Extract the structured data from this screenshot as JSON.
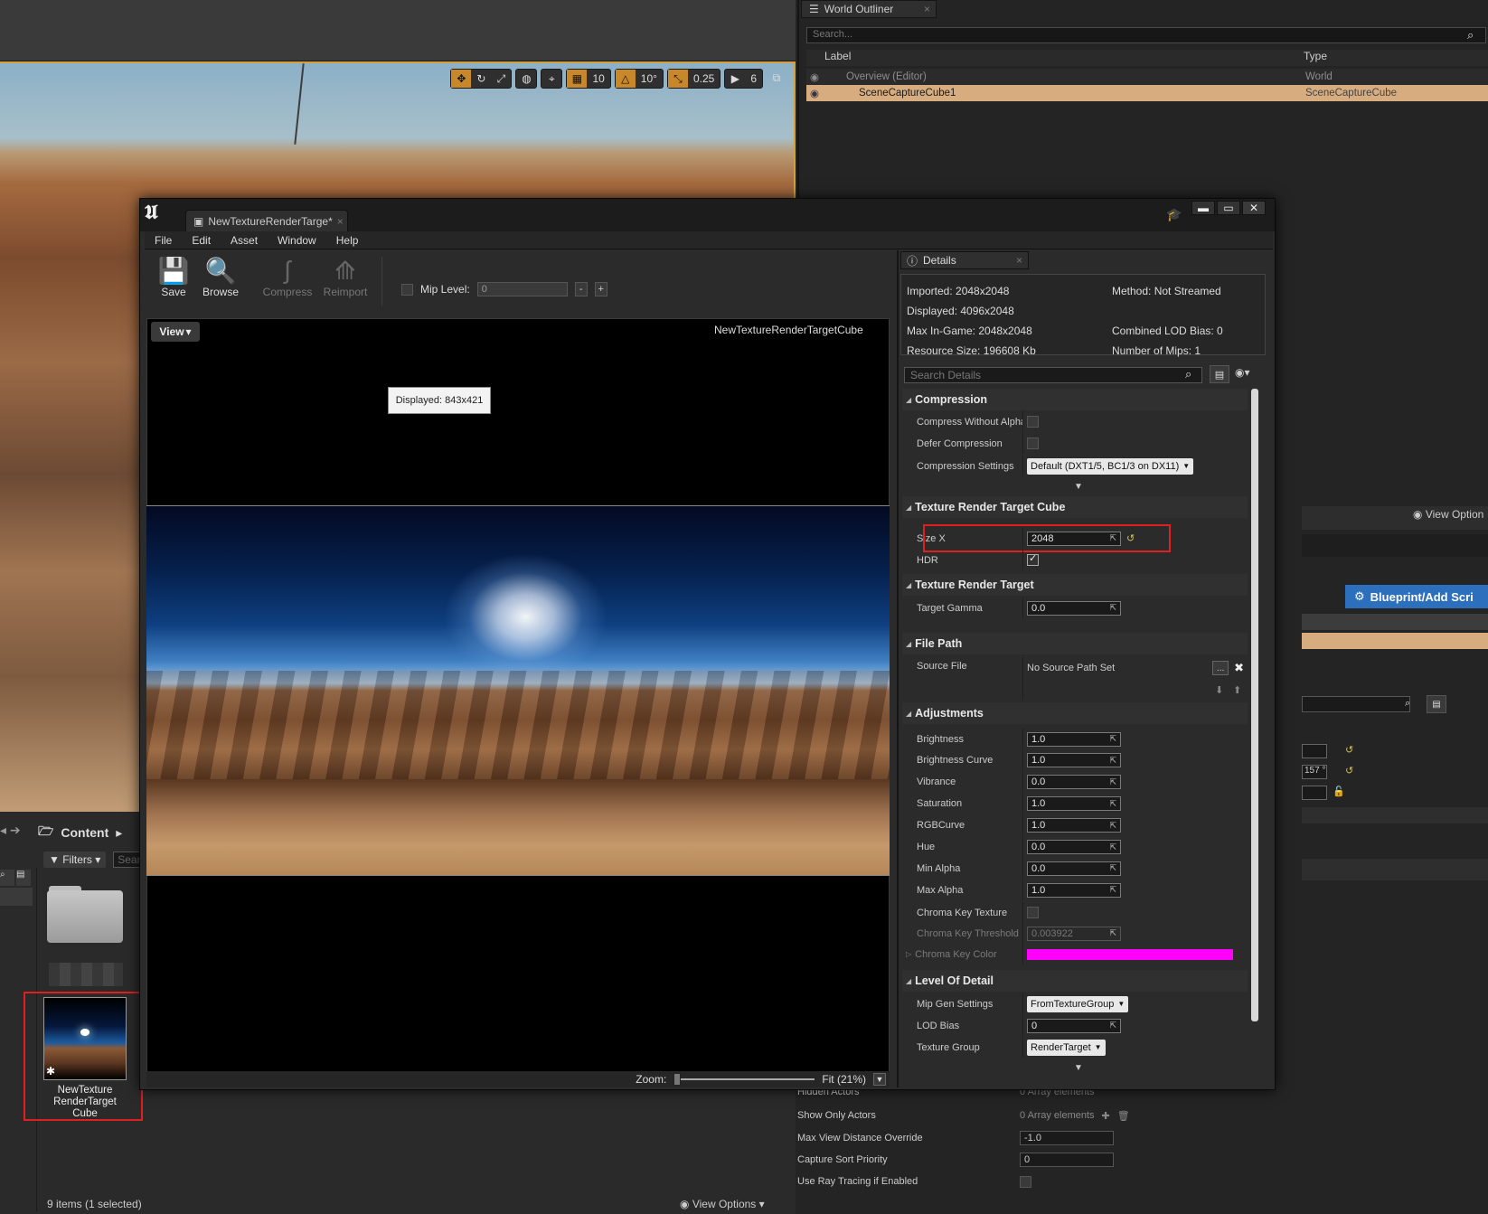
{
  "background": {
    "viewport_toolbar": {
      "grid_snap": "10",
      "rotation_snap": "10°",
      "scale_snap": "0.25",
      "camera_speed": "6"
    },
    "outliner": {
      "tab_label": "World Outliner",
      "search_placeholder": "Search...",
      "col_label": "Label",
      "col_type": "Type",
      "rows": [
        {
          "label": "Overview (Editor)",
          "type": "World"
        },
        {
          "label": "SceneCaptureCube1",
          "type": "SceneCaptureCube"
        }
      ]
    },
    "right_panel": {
      "view_options": "View Option",
      "blueprint_button": "Blueprint/Add Scri",
      "partial_value": "157 °"
    },
    "content_browser": {
      "breadcrumb": "Content",
      "filters": "Filters",
      "search_placeholder": "Search",
      "asset_name": "NewTexture RenderTarget Cube",
      "status": "9 items (1 selected)",
      "view_options": "View Options"
    },
    "props": {
      "hidden_actors_label": "Hidden Actors",
      "hidden_actors_value": "0 Array elements",
      "show_only_actors_label": "Show Only Actors",
      "show_only_actors_value": "0 Array elements",
      "max_view_distance_label": "Max View Distance Override",
      "max_view_distance_value": "-1.0",
      "capture_sort_priority_label": "Capture Sort Priority",
      "capture_sort_priority_value": "0",
      "ray_tracing_label": "Use Ray Tracing if Enabled"
    }
  },
  "texture_editor": {
    "tab_title": "NewTextureRenderTarge*",
    "menu": [
      "File",
      "Edit",
      "Asset",
      "Window",
      "Help"
    ],
    "toolbar": {
      "save": "Save",
      "browse": "Browse",
      "compress": "Compress",
      "reimport": "Reimport",
      "mip_label": "Mip Level:",
      "mip_value": "0"
    },
    "viewport": {
      "view_button": "View",
      "asset_name": "NewTextureRenderTargetCube",
      "tooltip": "Displayed: 843x421",
      "zoom_label": "Zoom:",
      "zoom_value": "Fit (21%)",
      "zoom_fraction": 0.21
    },
    "details": {
      "tab_label": "Details",
      "info": {
        "imported": "Imported: 2048x2048",
        "method": "Method: Not Streamed",
        "displayed": "Displayed: 4096x2048",
        "max_ingame": "Max In-Game: 2048x2048",
        "combined_lod": "Combined LOD Bias: 0",
        "resource_size": "Resource Size: 196608 Kb",
        "num_mips": "Number of Mips: 1"
      },
      "search_placeholder": "Search Details",
      "compression": {
        "title": "Compression",
        "compress_without_alpha": "Compress Without Alpha",
        "defer_compression": "Defer Compression",
        "compression_settings": "Compression Settings",
        "compression_settings_value": "Default (DXT1/5, BC1/3 on DX11)"
      },
      "trt_cube": {
        "title": "Texture Render Target Cube",
        "size_x": "Size X",
        "size_x_value": "2048",
        "hdr": "HDR"
      },
      "trt": {
        "title": "Texture Render Target",
        "target_gamma": "Target Gamma",
        "target_gamma_value": "0.0"
      },
      "file_path": {
        "title": "File Path",
        "source_file": "Source File",
        "source_file_value": "No Source Path Set",
        "browse_button": "..."
      },
      "adjustments": {
        "title": "Adjustments",
        "rows": [
          {
            "label": "Brightness",
            "value": "1.0"
          },
          {
            "label": "Brightness Curve",
            "value": "1.0"
          },
          {
            "label": "Vibrance",
            "value": "0.0"
          },
          {
            "label": "Saturation",
            "value": "1.0"
          },
          {
            "label": "RGBCurve",
            "value": "1.0"
          },
          {
            "label": "Hue",
            "value": "0.0"
          },
          {
            "label": "Min Alpha",
            "value": "0.0"
          },
          {
            "label": "Max Alpha",
            "value": "1.0"
          }
        ],
        "chroma_key_texture": "Chroma Key Texture",
        "chroma_key_threshold": "Chroma Key Threshold",
        "chroma_key_threshold_value": "0.003922",
        "chroma_key_color": "Chroma Key Color",
        "chroma_key_color_hex": "#ff00ff"
      },
      "lod": {
        "title": "Level Of Detail",
        "mip_gen_settings": "Mip Gen Settings",
        "mip_gen_settings_value": "FromTextureGroup",
        "lod_bias": "LOD Bias",
        "lod_bias_value": "0",
        "texture_group": "Texture Group",
        "texture_group_value": "RenderTarget"
      }
    }
  },
  "colors": {
    "accent_orange": "#c8882a",
    "selection_row": "#d7ad7f",
    "highlight_red": "#e02020",
    "blueprint_blue": "#2b6fbd"
  }
}
